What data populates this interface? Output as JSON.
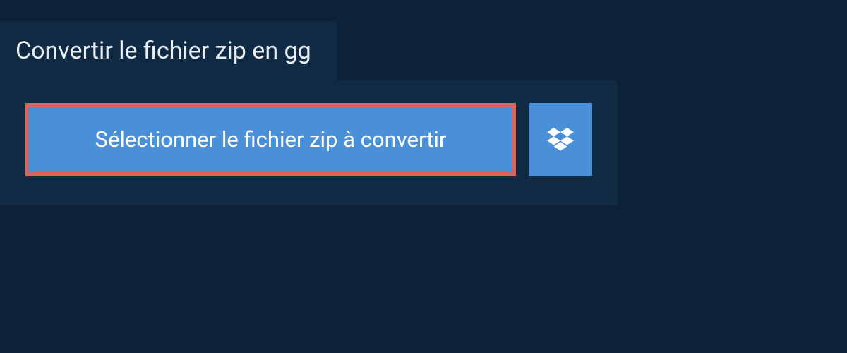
{
  "header": {
    "title": "Convertir le fichier zip en gg"
  },
  "actions": {
    "select_file_label": "Sélectionner le fichier zip à convertir",
    "dropbox_icon": "dropbox-icon"
  },
  "colors": {
    "background": "#0e2237",
    "panel": "#102a43",
    "button_primary": "#4a90d9",
    "highlight_border": "#d96459",
    "text_light": "#e8eef3"
  }
}
